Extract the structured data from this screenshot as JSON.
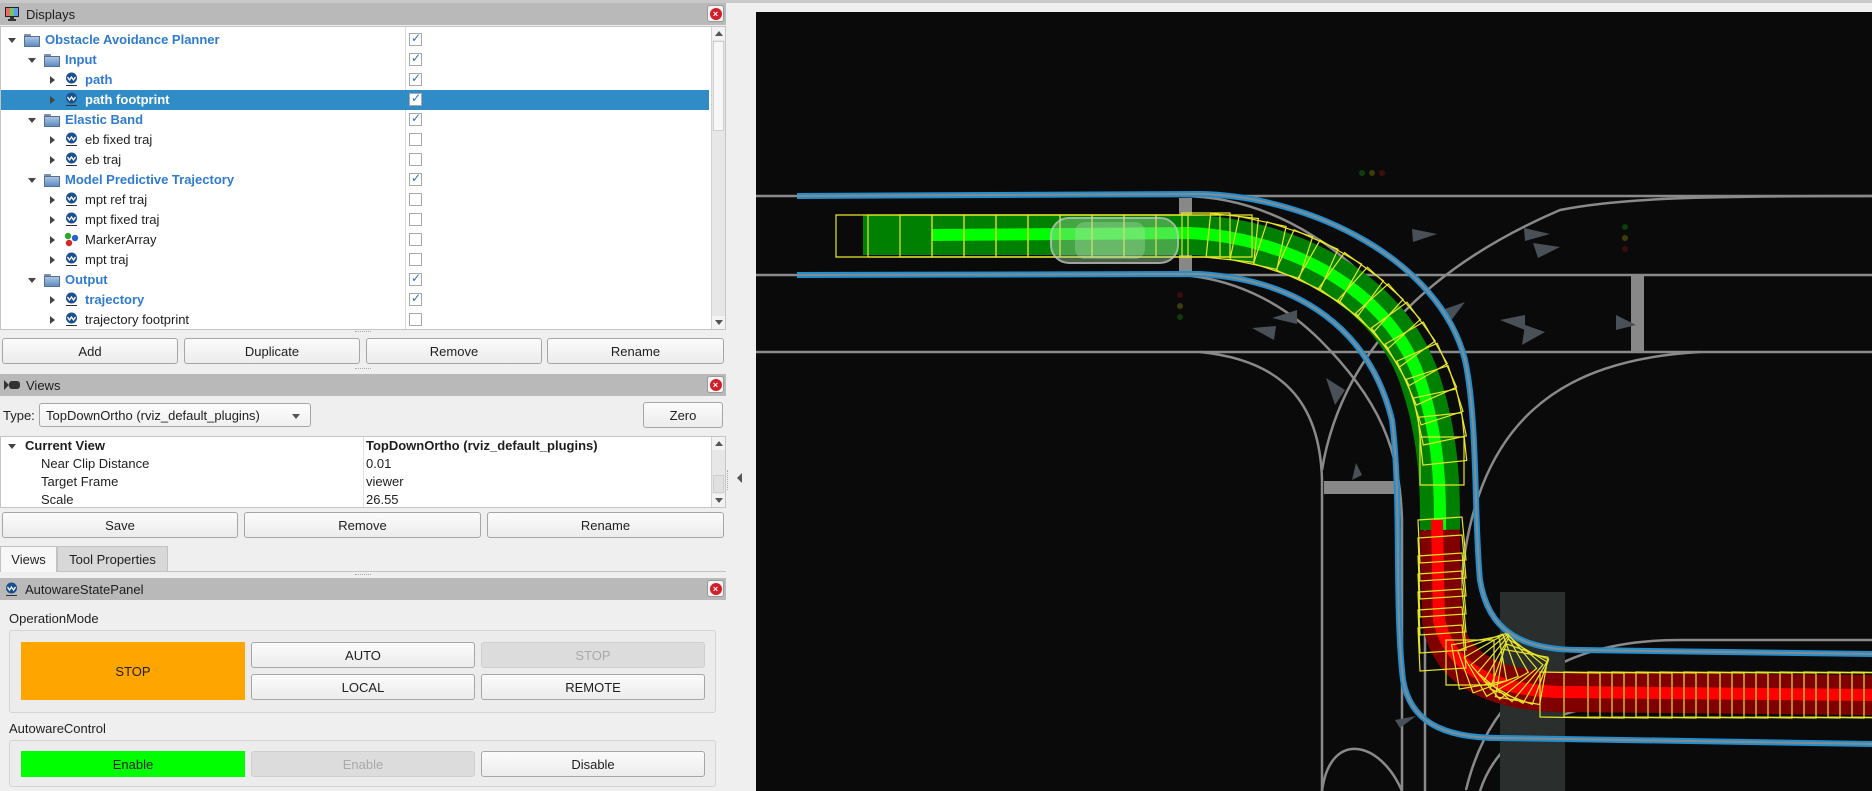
{
  "displays": {
    "title": "Displays",
    "icon": "monitor-icon",
    "tree": [
      {
        "label": "Obstacle Avoidance Planner",
        "depth": 0,
        "kind": "group",
        "expanded": true,
        "checked": true,
        "style": "group"
      },
      {
        "label": "Input",
        "depth": 1,
        "kind": "group",
        "expanded": true,
        "checked": true,
        "style": "group"
      },
      {
        "label": "path",
        "depth": 2,
        "kind": "autoware",
        "expanded": false,
        "checked": true,
        "style": "enabled"
      },
      {
        "label": "path footprint",
        "depth": 2,
        "kind": "autoware",
        "expanded": false,
        "checked": true,
        "style": "enabled",
        "selected": true
      },
      {
        "label": "Elastic Band",
        "depth": 1,
        "kind": "group",
        "expanded": true,
        "checked": true,
        "style": "group"
      },
      {
        "label": "eb fixed traj",
        "depth": 2,
        "kind": "autoware",
        "expanded": false,
        "checked": false,
        "style": "plain"
      },
      {
        "label": "eb traj",
        "depth": 2,
        "kind": "autoware",
        "expanded": false,
        "checked": false,
        "style": "plain"
      },
      {
        "label": "Model Predictive Trajectory",
        "depth": 1,
        "kind": "group",
        "expanded": true,
        "checked": true,
        "style": "group"
      },
      {
        "label": "mpt ref traj",
        "depth": 2,
        "kind": "autoware",
        "expanded": false,
        "checked": false,
        "style": "plain"
      },
      {
        "label": "mpt fixed traj",
        "depth": 2,
        "kind": "autoware",
        "expanded": false,
        "checked": false,
        "style": "plain"
      },
      {
        "label": "MarkerArray",
        "depth": 2,
        "kind": "marker",
        "expanded": false,
        "checked": false,
        "style": "plain"
      },
      {
        "label": "mpt traj",
        "depth": 2,
        "kind": "autoware",
        "expanded": false,
        "checked": false,
        "style": "plain"
      },
      {
        "label": "Output",
        "depth": 1,
        "kind": "group",
        "expanded": true,
        "checked": true,
        "style": "group"
      },
      {
        "label": "trajectory",
        "depth": 2,
        "kind": "autoware",
        "expanded": false,
        "checked": true,
        "style": "enabled"
      },
      {
        "label": "trajectory footprint",
        "depth": 2,
        "kind": "autoware",
        "expanded": false,
        "checked": false,
        "style": "plain"
      }
    ],
    "buttons": {
      "add": "Add",
      "duplicate": "Duplicate",
      "remove": "Remove",
      "rename": "Rename"
    }
  },
  "views": {
    "title": "Views",
    "type_label": "Type:",
    "type_value": "TopDownOrtho (rviz_default_plugins)",
    "zero_label": "Zero",
    "properties": [
      {
        "key": "Current View",
        "value": "TopDownOrtho (rviz_default_plugins)",
        "head": true
      },
      {
        "key": "Near Clip Distance",
        "value": "0.01"
      },
      {
        "key": "Target Frame",
        "value": "viewer"
      },
      {
        "key": "Scale",
        "value": "26.55"
      }
    ],
    "buttons": {
      "save": "Save",
      "remove": "Remove",
      "rename": "Rename"
    },
    "tabs": [
      {
        "label": "Views",
        "active": true
      },
      {
        "label": "Tool Properties",
        "active": false
      }
    ]
  },
  "autoware_state_panel": {
    "title": "AutowareStatePanel",
    "operation_mode": {
      "label": "OperationMode",
      "status": "STOP",
      "status_color": "#ffa500",
      "buttons": [
        {
          "label": "AUTO",
          "enabled": true
        },
        {
          "label": "STOP",
          "enabled": false
        },
        {
          "label": "LOCAL",
          "enabled": true
        },
        {
          "label": "REMOTE",
          "enabled": true
        }
      ]
    },
    "autoware_control": {
      "label": "AutowareControl",
      "status": "Enable",
      "status_color": "#00ff00",
      "buttons": [
        {
          "label": "Enable",
          "enabled": false
        },
        {
          "label": "Disable",
          "enabled": true
        }
      ]
    }
  },
  "viewport": {
    "background": "#0a0a0a",
    "colors": {
      "lane_bound": "#1e8fd0",
      "lanelet_line": "#8a8a8a",
      "path_green_dark": "#008000",
      "path_green_light": "#00ff00",
      "traj_red_dark": "#800000",
      "traj_red_light": "#ff0000",
      "footprint": "#e6e62a"
    }
  }
}
